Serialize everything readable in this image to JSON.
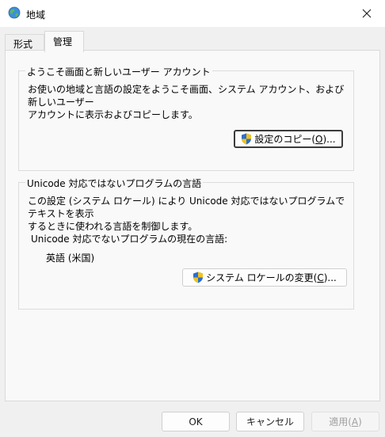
{
  "window": {
    "title": "地域",
    "icon": "globe-icon",
    "close_icon": "close-icon"
  },
  "tabs": [
    {
      "label": "形式",
      "active": false
    },
    {
      "label": "管理",
      "active": true
    }
  ],
  "welcome_group": {
    "legend": "ようこそ画面と新しいユーザー アカウント",
    "desc_line1": "お使いの地域と言語の設定をようこそ画面、システム アカウント、および新しいユーザー",
    "desc_line2": "アカウントに表示およびコピーします。",
    "button_prefix": "設定のコピー(",
    "button_mnemonic": "O",
    "button_suffix": ")..."
  },
  "unicode_group": {
    "legend": "Unicode 対応ではないプログラムの言語",
    "desc_line1": "この設定 (システム ロケール) により Unicode 対応ではないプログラムでテキストを表示",
    "desc_line2": "するときに使われる言語を制御します。",
    "current_label": "Unicode 対応でないプログラムの現在の言語:",
    "current_value": "英語 (米国)",
    "button_prefix": "システム ロケールの変更(",
    "button_mnemonic": "C",
    "button_suffix": ")..."
  },
  "footer": {
    "ok": "OK",
    "cancel": "キャンセル",
    "apply_prefix": "適用(",
    "apply_mnemonic": "A",
    "apply_suffix": ")"
  },
  "colors": {
    "window_bg": "#f0f0f0",
    "panel_bg": "#f9f9f9",
    "shield_blue": "#2a6fd1",
    "shield_yellow": "#f2c21b"
  }
}
